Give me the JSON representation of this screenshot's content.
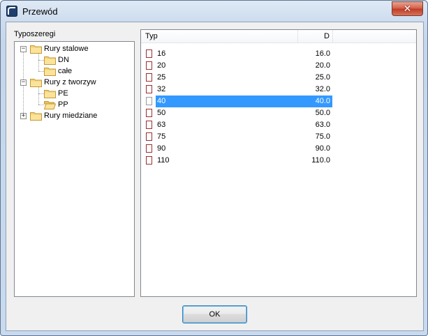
{
  "window": {
    "title": "Przewód",
    "close_label": "✕"
  },
  "tree": {
    "label": "Typoszeregi",
    "nodes": [
      {
        "label": "Rury stalowe",
        "expander": "−"
      },
      {
        "label": "DN"
      },
      {
        "label": "całe"
      },
      {
        "label": "Rury z tworzyw",
        "expander": "−"
      },
      {
        "label": "PE"
      },
      {
        "label": "PP"
      },
      {
        "label": "Rury miedziane",
        "expander": "+"
      }
    ]
  },
  "list": {
    "columns": [
      "Typ",
      "D"
    ],
    "rows": [
      {
        "typ": "16",
        "d": "16.0"
      },
      {
        "typ": "20",
        "d": "20.0"
      },
      {
        "typ": "25",
        "d": "25.0"
      },
      {
        "typ": "32",
        "d": "32.0"
      },
      {
        "typ": "40",
        "d": "40.0"
      },
      {
        "typ": "50",
        "d": "50.0"
      },
      {
        "typ": "63",
        "d": "63.0"
      },
      {
        "typ": "75",
        "d": "75.0"
      },
      {
        "typ": "90",
        "d": "90.0"
      },
      {
        "typ": "110",
        "d": "110.0"
      }
    ],
    "selected_index": 4
  },
  "buttons": {
    "ok_label": "OK"
  }
}
